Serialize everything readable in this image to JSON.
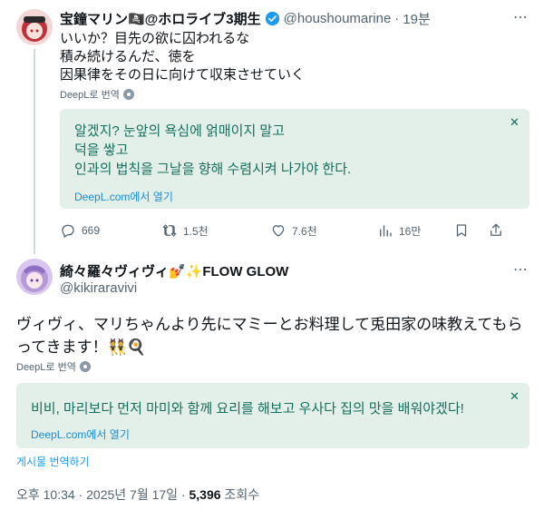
{
  "post1": {
    "display_name": "宝鐘マリン🏴‍☠️@ホロライブ3期生",
    "handle": "@houshoumarine",
    "time": "19분",
    "lines": [
      "いいか？目先の欲に囚われるな",
      "積み続けるんだ、徳を",
      "因果律をその日に向けて収束させていく"
    ],
    "deepl_label": "DeepL로 번역",
    "translation": [
      "알겠지? 눈앞의 욕심에 얽매이지 말고",
      "덕을 쌓고",
      "인과의 법칙을 그날을 향해 수렴시켜 나가야 한다."
    ],
    "deepl_link": "DeepL.com에서 열기",
    "stats": {
      "replies": "669",
      "reposts": "1.5천",
      "likes": "7.6천",
      "views": "16만"
    }
  },
  "post2": {
    "display_name": "綺々羅々ヴィヴィ💅✨FLOW GLOW",
    "handle": "@kikiraravivi",
    "lines": [
      "ヴィヴィ、マリちゃんより先にマミーとお料理して兎田家の味教えてもら",
      "ってきます！👯🍳"
    ],
    "deepl_label": "DeepL로 번역",
    "translation": "비비, 마리보다 먼저 마미와 함께 요리를 해보고 우사다 집의 맛을 배워야겠다!",
    "deepl_link": "DeepL.com에서 열기",
    "translate_post": "게시물 번역하기",
    "timestamp": "오후 10:34 · 2025년 7월 17일 · ",
    "views_count": "5,396",
    "views_label": " 조회수"
  },
  "icons": {
    "more": "more-horizontal-icon",
    "close": "close-icon"
  },
  "colors": {
    "accent": "#1d9bf0",
    "translation_bg": "#e3efe9",
    "translation_text": "#166f5c",
    "muted": "#536471"
  }
}
